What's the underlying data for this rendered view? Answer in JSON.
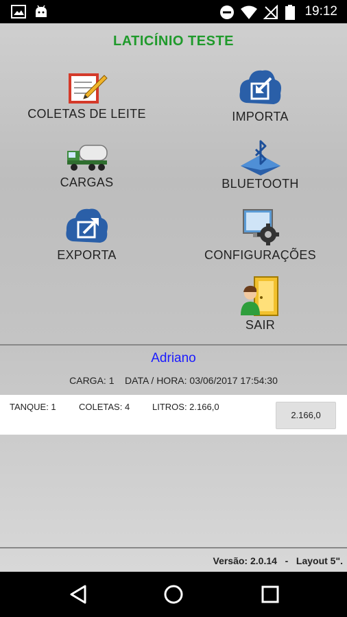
{
  "status_bar": {
    "time": "19:12"
  },
  "app": {
    "title": "LATICÍNIO TESTE",
    "menu": [
      {
        "id": "coletas",
        "label": "COLETAS DE LEITE",
        "icon": "clipboard-pencil-icon"
      },
      {
        "id": "importa",
        "label": "IMPORTA",
        "icon": "cloud-import-icon"
      },
      {
        "id": "cargas",
        "label": "CARGAS",
        "icon": "tanker-truck-icon"
      },
      {
        "id": "bluetooth",
        "label": "BLUETOOTH",
        "icon": "bluetooth-icon"
      },
      {
        "id": "exporta",
        "label": "EXPORTA",
        "icon": "cloud-export-icon"
      },
      {
        "id": "configuracoes",
        "label": "CONFIGURAÇÕES",
        "icon": "settings-gear-icon"
      },
      {
        "id": "sair",
        "label": "SAIR",
        "icon": "exit-door-icon"
      }
    ]
  },
  "session": {
    "user": "Adriano",
    "carga_line": "CARGA: 1    DATA / HORA: 03/06/2017 17:54:30"
  },
  "tank_row": {
    "tanque": "TANQUE: 1",
    "coletas": "COLETAS: 4",
    "litros": "LITROS: 2.166,0",
    "button_label": "2.166,0"
  },
  "footer": {
    "version": "Versão: 2.0.14   -   Layout 5\"."
  }
}
